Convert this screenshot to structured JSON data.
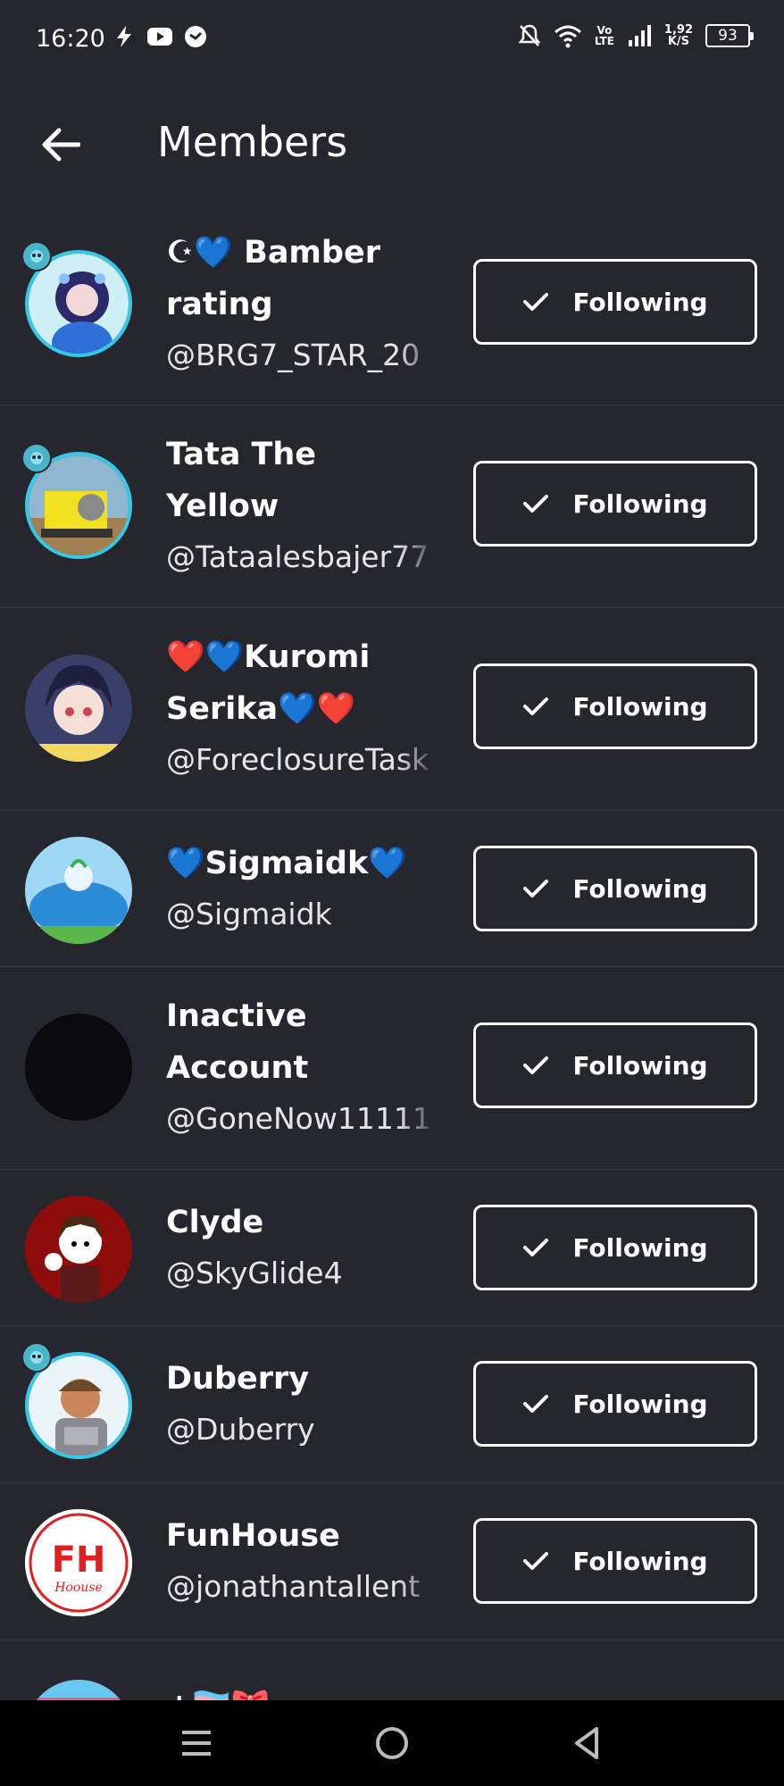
{
  "status_bar": {
    "time": "16:20",
    "net_rate_top": "1,92",
    "net_rate_bottom": "K/S",
    "vo_top": "Vo",
    "vo_bottom": "LTE",
    "battery": "93"
  },
  "header": {
    "title": "Members"
  },
  "follow_label": "Following",
  "members": [
    {
      "name": "☪💙 Bamber rating gaming...",
      "handle": "@BRG7_STAR_20",
      "name_lines": 2
    },
    {
      "name": "Tata The Yellow Pannie...",
      "handle": "@Tataalesbajer77",
      "name_lines": 2
    },
    {
      "name": "❤️💙Kuromi Serika💙❤️",
      "handle": "@ForeclosureTask",
      "name_lines": 2
    },
    {
      "name": "💙Sigmaidk💙",
      "handle": "@Sigmaidk",
      "name_lines": 1
    },
    {
      "name": "Inactive Account",
      "handle": "@GoneNow11111",
      "name_lines": 2
    },
    {
      "name": "Clyde",
      "handle": "@SkyGlide4",
      "name_lines": 1
    },
    {
      "name": "Duberry",
      "handle": "@Duberry",
      "name_lines": 1
    },
    {
      "name": "FunHouse",
      "handle": "@jonathantallent",
      "name_lines": 1
    },
    {
      "name": "+🏳️‍⚧️🎀",
      "handle": "",
      "name_lines": 1
    }
  ],
  "avatar_logo_text": "FH",
  "avatar_logo_subtext": "Hoouse"
}
